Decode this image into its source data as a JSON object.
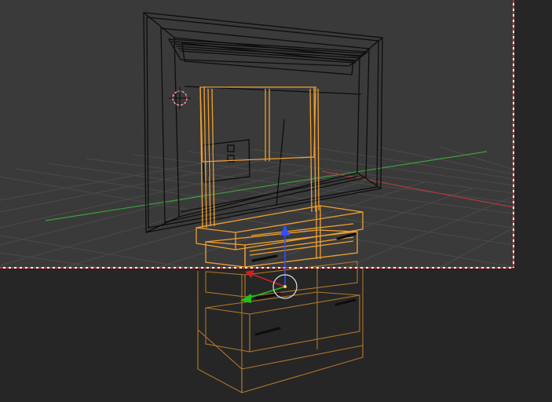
{
  "viewport": {
    "colors": {
      "background_upper": "#3a3a3a",
      "background_lower": "#262626",
      "grid_line": "#4a4a4a",
      "axis_x": "#b03a3a",
      "axis_y": "#3aa03a",
      "wire_unselected": "#0d0d0d",
      "wire_selected": "#f0a030",
      "gizmo_x": "#d02020",
      "gizmo_y": "#20c020",
      "gizmo_z": "#3050ff",
      "border_guide": "#d22a2a",
      "cursor_ring": "#e8e8e8",
      "cursor_accent": "#d03030"
    },
    "objects": [
      {
        "name": "tv",
        "selected": false
      },
      {
        "name": "tv-stand",
        "selected": true
      }
    ],
    "transform_gizmo": {
      "axes": [
        "x",
        "y",
        "z"
      ]
    },
    "cursor_3d": {
      "visible": true
    },
    "guides": {
      "frame_border": "dashed"
    }
  }
}
